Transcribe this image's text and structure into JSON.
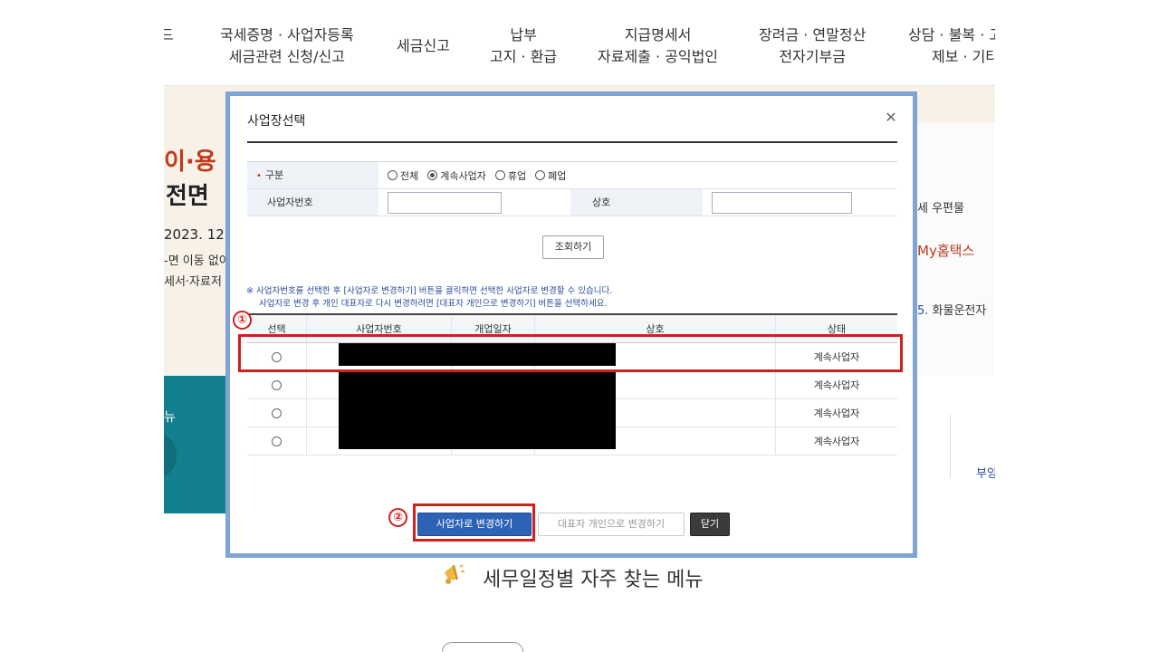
{
  "topnav": {
    "items": [
      {
        "line1": "",
        "line2": "드"
      },
      {
        "line1": "국세증명 · 사업자등록",
        "line2": "세금관련 신청/신고"
      },
      {
        "line1": "세금신고",
        "line2": ""
      },
      {
        "line1": "납부",
        "line2": "고지 · 환급"
      },
      {
        "line1": "지급명세서",
        "line2": "자료제출 · 공익법인"
      },
      {
        "line1": "장려금 · 연말정산",
        "line2": "전자기부금"
      },
      {
        "line1": "상담 · 불복 · 고",
        "line2": "제보 · 기타"
      }
    ]
  },
  "background": {
    "headline1": "이·용",
    "headline2": "전면",
    "date": "2023. 12.",
    "sub1": "-면 이동 없이",
    "sub2": "세서·자료저",
    "right_link1": "세 우편물",
    "right_link2": "My홈택스",
    "right_link3": "화물운전자",
    "teal_text": "뉴",
    "right_bottom": "부양"
  },
  "modal": {
    "title": "사업장선택",
    "close_symbol": "✕",
    "type_label": "구분",
    "required_mark": "•",
    "radio_options": [
      {
        "label": "전체",
        "checked": false
      },
      {
        "label": "계속사업자",
        "checked": true
      },
      {
        "label": "휴업",
        "checked": false
      },
      {
        "label": "폐업",
        "checked": false
      }
    ],
    "bizno_label": "사업자번호",
    "bizno_value": "",
    "company_label": "상호",
    "company_value": "",
    "search_button": "조회하기",
    "notice_line1": "※ 사업자번호를 선택한 후 [사업자로 변경하기] 버튼을 클릭하면 선택한 사업자로 변경할 수 있습니다.",
    "notice_line2": "사업자로 변경 후 개인 대표자로 다시 변경하려면 [대표자 개인으로 변경하기] 버튼을 선택하세요.",
    "columns": [
      "선택",
      "사업자번호",
      "개업일자",
      "상호",
      "상태"
    ],
    "rows": [
      {
        "status": "계속사업자"
      },
      {
        "status": "계속사업자"
      },
      {
        "status": "계속사업자"
      },
      {
        "status": "계속사업자"
      }
    ],
    "btn_change_business": "사업자로 변경하기",
    "btn_change_personal": "대표자 개인으로 변경하기",
    "btn_close": "닫기"
  },
  "annotations": {
    "marker1": "①",
    "marker2": "②",
    "color": "#d41f1f"
  },
  "bottom": {
    "title": "세무일정별 자주 찾는 메뉴"
  }
}
